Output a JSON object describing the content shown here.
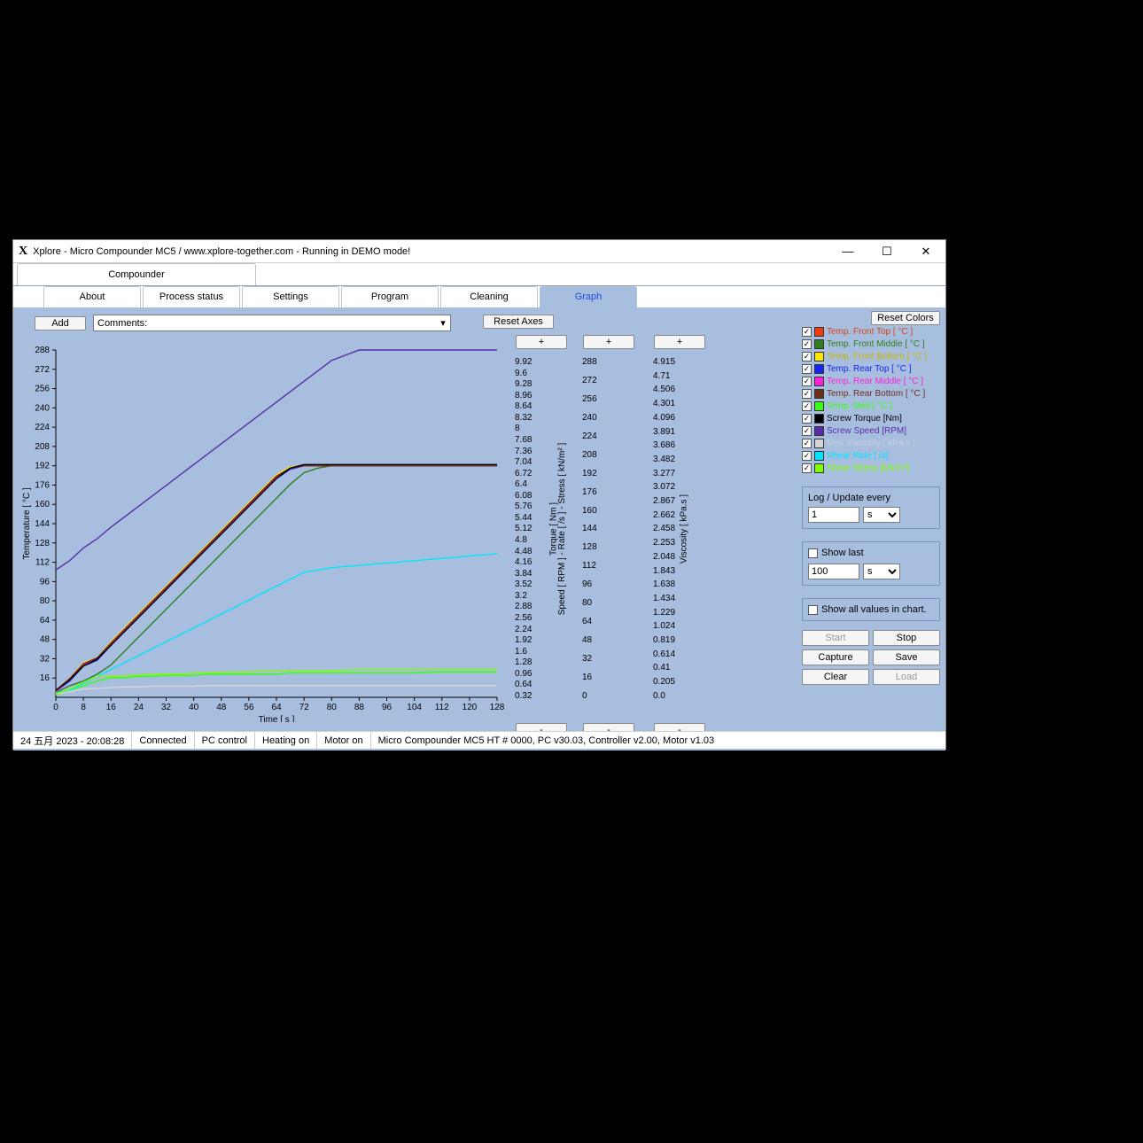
{
  "window": {
    "title": "Xplore - Micro Compounder MC5 / www.xplore-together.com - Running in DEMO mode!"
  },
  "main_tab": "Compounder",
  "tabs": [
    "About",
    "Process status",
    "Settings",
    "Program",
    "Cleaning",
    "Graph"
  ],
  "active_tab": "Graph",
  "toolbar": {
    "add_label": "Add",
    "comments_placeholder": "Comments:",
    "reset_axes_label": "Reset Axes",
    "plus_label": "+",
    "minus_label": "-"
  },
  "right": {
    "reset_colors_label": "Reset Colors",
    "legend": [
      {
        "label": "Temp. Front Top  [ °C ]",
        "color": "#ef3b10",
        "text": "#d84315"
      },
      {
        "label": "Temp. Front Middle  [ °C ]",
        "color": "#2f7d1f",
        "text": "#2f7d1f"
      },
      {
        "label": "Temp. Front Bottom  [ °C ]",
        "color": "#ffe600",
        "text": "#c9b500"
      },
      {
        "label": "Temp. Rear Top  [ °C ]",
        "color": "#1a22f0",
        "text": "#1a22f0"
      },
      {
        "label": "Temp. Rear Middle  [ °C ]",
        "color": "#ff1fd6",
        "text": "#ff1fd6"
      },
      {
        "label": "Temp. Rear Bottom  [ °C ]",
        "color": "#6b2e1a",
        "text": "#6b2e1a"
      },
      {
        "label": "Temp. Melt  [ °C ]",
        "color": "#39ff14",
        "text": "#39ff14"
      },
      {
        "label": "Screw Torque  [Nm]",
        "color": "#000000",
        "text": "#000000"
      },
      {
        "label": "Screw Speed  [RPM]",
        "color": "#5a2da8",
        "text": "#5a2da8"
      },
      {
        "label": "Melt Viscosity  [ kPa.s ]",
        "color": "#d6d6d6",
        "text": "#c5cde0"
      },
      {
        "label": "Shear Rate  [ /s]",
        "color": "#00e5ff",
        "text": "#00e5ff"
      },
      {
        "label": "Shear Stress  [kN/m²]",
        "color": "#7fff00",
        "text": "#7fff00"
      }
    ],
    "log_label": "Log / Update every",
    "log_value": "1",
    "log_unit": "s",
    "show_last_label": "Show last",
    "show_last_value": "100",
    "show_last_unit": "s",
    "show_all_label": "Show all values in chart.",
    "buttons": {
      "start": "Start",
      "stop": "Stop",
      "capture": "Capture",
      "save": "Save",
      "clear": "Clear",
      "load": "Load"
    }
  },
  "axes": {
    "x_label": "Time  [ s ]",
    "y1_label": "Temperature  [ °C ]",
    "y2_label": "Torque  [ Nm ]",
    "y3_label": "Speed  [ RPM ] - Rate  [ /s ] - Stress  [ kN/m² ]",
    "y4_label": "Viscosity  [ kPa.s ]",
    "x_ticks": [
      "0",
      "8",
      "16",
      "24",
      "32",
      "40",
      "48",
      "56",
      "64",
      "72",
      "80",
      "88",
      "96",
      "104",
      "112",
      "120",
      "128"
    ],
    "y1_ticks": [
      "288",
      "272",
      "256",
      "240",
      "224",
      "208",
      "192",
      "176",
      "160",
      "144",
      "128",
      "112",
      "96",
      "80",
      "64",
      "48",
      "32",
      "16"
    ],
    "y2_ticks": [
      "9.92",
      "9.6",
      "9.28",
      "8.96",
      "8.64",
      "8.32",
      "8",
      "7.68",
      "7.36",
      "7.04",
      "6.72",
      "6.4",
      "6.08",
      "5.76",
      "5.44",
      "5.12",
      "4.8",
      "4.48",
      "4.16",
      "3.84",
      "3.52",
      "3.2",
      "2.88",
      "2.56",
      "2.24",
      "1.92",
      "1.6",
      "1.28",
      "0.96",
      "0.64",
      "0.32"
    ],
    "y3_ticks": [
      "288",
      "272",
      "256",
      "240",
      "224",
      "208",
      "192",
      "176",
      "160",
      "144",
      "128",
      "112",
      "96",
      "80",
      "64",
      "48",
      "32",
      "16",
      "0"
    ],
    "y4_ticks": [
      "4.915",
      "4.71",
      "4.506",
      "4.301",
      "4.096",
      "3.891",
      "3.686",
      "3.482",
      "3.277",
      "3.072",
      "2.867",
      "2.662",
      "2.458",
      "2.253",
      "2.048",
      "1.843",
      "1.638",
      "1.434",
      "1.229",
      "1.024",
      "0.819",
      "0.614",
      "0.41",
      "0.205",
      "0.0"
    ]
  },
  "status": {
    "datetime": "24 五月 2023  -  20:08:28",
    "conn": "Connected",
    "pc": "PC control",
    "heating": "Heating on",
    "motor": "Motor on",
    "info": "Micro Compounder MC5 HT # 0000, PC v30.03, Controller v2.00, Motor v1.03"
  },
  "chart_data": {
    "type": "line",
    "xlabel": "Time [s]",
    "xlim": [
      0,
      128
    ],
    "axes": {
      "temperature": {
        "label": "Temperature [°C]",
        "lim": [
          0,
          300
        ]
      },
      "torque": {
        "label": "Torque [Nm]",
        "lim": [
          0,
          10
        ]
      },
      "speed": {
        "label": "Speed/Rate/Stress",
        "lim": [
          0,
          300
        ]
      },
      "viscosity": {
        "label": "Viscosity [kPa.s]",
        "lim": [
          0,
          5
        ]
      }
    },
    "x": [
      0,
      4,
      8,
      12,
      16,
      20,
      24,
      28,
      32,
      36,
      40,
      44,
      48,
      52,
      56,
      60,
      64,
      68,
      72,
      76,
      80,
      88,
      96,
      104,
      112,
      120,
      128
    ],
    "series": [
      {
        "name": "Temp. Front Top",
        "axis": "temperature",
        "color": "#ef3b10",
        "y": [
          6,
          15,
          28,
          33,
          46,
          58,
          70,
          82,
          94,
          106,
          118,
          130,
          142,
          154,
          166,
          178,
          190,
          198,
          200,
          200,
          200,
          200,
          200,
          200,
          200,
          200,
          200
        ]
      },
      {
        "name": "Temp. Front Middle",
        "axis": "temperature",
        "color": "#2f7d1f",
        "y": [
          4,
          10,
          14,
          20,
          28,
          40,
          52,
          64,
          76,
          88,
          100,
          112,
          124,
          136,
          148,
          160,
          172,
          184,
          194,
          198,
          200,
          200,
          200,
          200,
          200,
          200,
          200
        ]
      },
      {
        "name": "Temp. Front Bottom",
        "axis": "temperature",
        "color": "#ffe600",
        "y": [
          6,
          16,
          30,
          34,
          48,
          60,
          72,
          84,
          96,
          108,
          120,
          132,
          144,
          156,
          168,
          180,
          192,
          199,
          200,
          200,
          200,
          200,
          200,
          200,
          200,
          200,
          200
        ]
      },
      {
        "name": "Temp. Rear Top",
        "axis": "temperature",
        "color": "#1a22f0",
        "y": [
          5,
          14,
          27,
          32,
          45,
          57,
          69,
          81,
          93,
          105,
          117,
          129,
          141,
          153,
          165,
          177,
          189,
          197,
          200,
          200,
          200,
          200,
          200,
          200,
          200,
          200,
          200
        ]
      },
      {
        "name": "Temp. Rear Middle",
        "axis": "temperature",
        "color": "#ff1fd6",
        "y": [
          5,
          15,
          28,
          33,
          46,
          58,
          70,
          82,
          94,
          106,
          118,
          130,
          142,
          154,
          166,
          178,
          190,
          198,
          200,
          200,
          200,
          200,
          200,
          200,
          200,
          200,
          200
        ]
      },
      {
        "name": "Temp. Rear Bottom",
        "axis": "temperature",
        "color": "#6b2e1a",
        "y": [
          6,
          16,
          29,
          34,
          47,
          59,
          71,
          83,
          95,
          107,
          119,
          131,
          143,
          155,
          167,
          179,
          191,
          198,
          200,
          200,
          200,
          200,
          200,
          200,
          200,
          200,
          200
        ]
      },
      {
        "name": "Temp. Melt",
        "axis": "temperature",
        "color": "#39ff14",
        "y": [
          2,
          6,
          10,
          14,
          17,
          17,
          18,
          18,
          19,
          19,
          19,
          20,
          20,
          20,
          20,
          20,
          20,
          21,
          21,
          21,
          21,
          21,
          21,
          21,
          22,
          22,
          22
        ]
      },
      {
        "name": "Screw Torque",
        "axis": "torque",
        "color": "#000000",
        "y": [
          0.2,
          0.5,
          0.9,
          1.1,
          1.5,
          1.9,
          2.3,
          2.7,
          3.1,
          3.5,
          3.9,
          4.3,
          4.7,
          5.1,
          5.5,
          5.9,
          6.3,
          6.6,
          6.7,
          6.7,
          6.7,
          6.7,
          6.7,
          6.7,
          6.7,
          6.7,
          6.7
        ]
      },
      {
        "name": "Screw Speed",
        "axis": "speed",
        "color": "#5a2da8",
        "y": [
          110,
          118,
          129,
          137,
          147,
          156,
          165,
          174,
          183,
          192,
          201,
          210,
          219,
          228,
          237,
          246,
          255,
          264,
          273,
          282,
          291,
          300,
          300,
          300,
          300,
          300,
          300
        ]
      },
      {
        "name": "Melt Viscosity",
        "axis": "viscosity",
        "color": "#d6d6d6",
        "y": [
          0.05,
          0.08,
          0.12,
          0.13,
          0.14,
          0.15,
          0.15,
          0.16,
          0.16,
          0.16,
          0.16,
          0.17,
          0.17,
          0.17,
          0.17,
          0.17,
          0.17,
          0.17,
          0.17,
          0.17,
          0.17,
          0.17,
          0.17,
          0.17,
          0.17,
          0.17,
          0.17
        ]
      },
      {
        "name": "Shear Rate",
        "axis": "speed",
        "color": "#00e5ff",
        "y": [
          4,
          6,
          12,
          18,
          24,
          30,
          36,
          42,
          48,
          54,
          60,
          66,
          72,
          78,
          84,
          90,
          96,
          102,
          108,
          110,
          112,
          114,
          116,
          118,
          120,
          122,
          124
        ]
      },
      {
        "name": "Shear Stress",
        "axis": "speed",
        "color": "#7fff00",
        "y": [
          3,
          7,
          13,
          18,
          18,
          19,
          19,
          20,
          20,
          20,
          21,
          21,
          22,
          22,
          22,
          23,
          23,
          23,
          23,
          23,
          23,
          24,
          24,
          24,
          24,
          24,
          24
        ]
      }
    ]
  }
}
